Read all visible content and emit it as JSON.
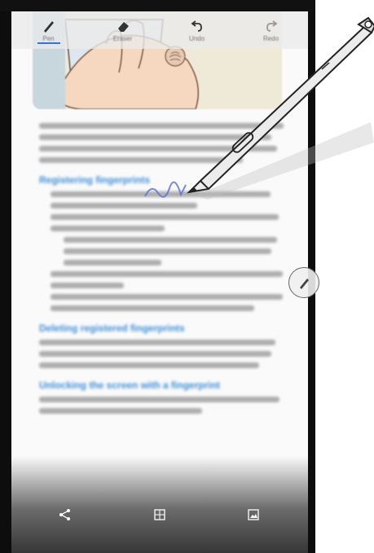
{
  "toolbar": {
    "pen": {
      "label": "Pen",
      "icon": "pen-icon"
    },
    "eraser": {
      "label": "Eraser",
      "icon": "eraser-icon"
    },
    "undo": {
      "label": "Undo",
      "icon": "undo-icon"
    },
    "redo": {
      "label": "Redo",
      "icon": "redo-icon"
    }
  },
  "headings": [
    "Registering fingerprints",
    "Deleting registered fingerprints",
    "Unlocking the screen with a fingerprint"
  ],
  "bottom_bar": {
    "icons": [
      "share-icon",
      "crop-icon",
      "image-icon"
    ]
  },
  "colors": {
    "accent": "#3a6fd8",
    "heading": "#3b8ed6",
    "phone_frame": "#0d0d0d"
  }
}
